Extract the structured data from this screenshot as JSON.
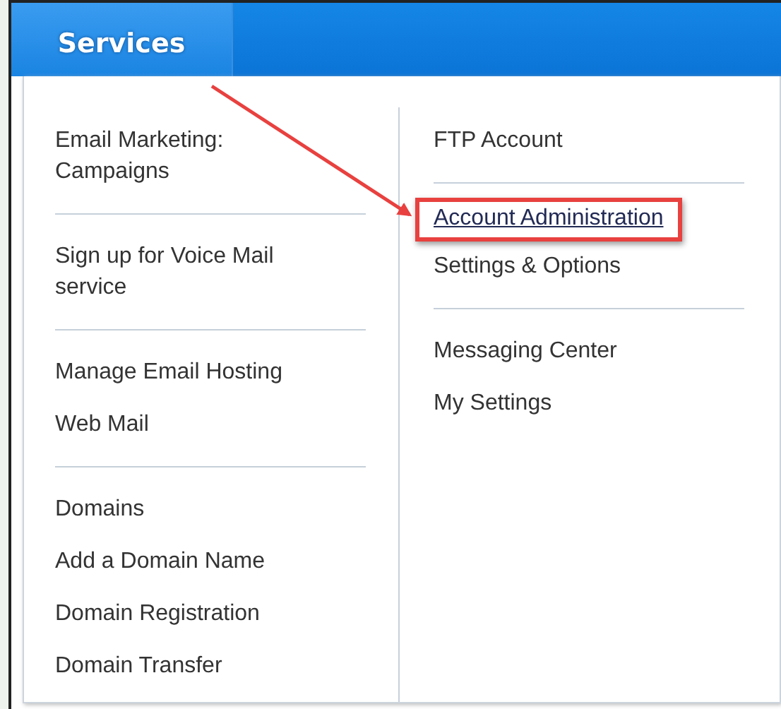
{
  "nav": {
    "tabs": [
      {
        "label": "Services",
        "selected": true
      }
    ]
  },
  "menu": {
    "columns": [
      {
        "groups": [
          [
            {
              "label": "Email Marketing: Campaigns",
              "hovered": false,
              "highlighted": false
            }
          ],
          [
            {
              "label": "Sign up for Voice Mail service",
              "hovered": false,
              "highlighted": false
            }
          ],
          [
            {
              "label": "Manage Email Hosting",
              "hovered": false,
              "highlighted": false
            },
            {
              "label": "Web Mail",
              "hovered": false,
              "highlighted": false
            }
          ],
          [
            {
              "label": "Domains",
              "hovered": false,
              "highlighted": false
            },
            {
              "label": "Add a Domain Name",
              "hovered": false,
              "highlighted": false
            },
            {
              "label": "Domain Registration",
              "hovered": false,
              "highlighted": false
            },
            {
              "label": "Domain Transfer",
              "hovered": false,
              "highlighted": false
            }
          ]
        ]
      },
      {
        "groups": [
          [
            {
              "label": "FTP Account",
              "hovered": false,
              "highlighted": false
            }
          ],
          [
            {
              "label": "Account Administration",
              "hovered": true,
              "highlighted": true
            },
            {
              "label": "Settings & Options",
              "hovered": false,
              "highlighted": false
            }
          ],
          [
            {
              "label": "Messaging Center",
              "hovered": false,
              "highlighted": false
            },
            {
              "label": "My Settings",
              "hovered": false,
              "highlighted": false
            }
          ]
        ]
      }
    ]
  },
  "annotation": {
    "arrow": true
  }
}
